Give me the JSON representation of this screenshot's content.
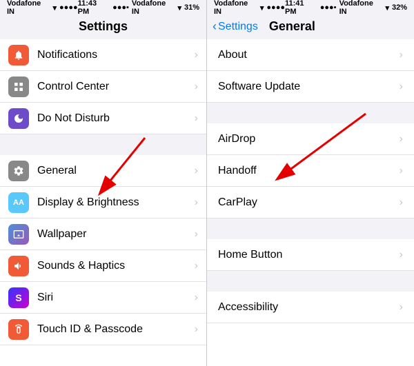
{
  "left": {
    "carrier": "Vodafone IN",
    "time": "11:43 PM",
    "signal": "▌▌▌▌",
    "wifi": "WiFi",
    "battery": "31%",
    "title": "Settings",
    "items": [
      {
        "id": "notifications",
        "label": "Notifications",
        "iconClass": "icon-notifications",
        "icon": "🔔"
      },
      {
        "id": "control-center",
        "label": "Control Center",
        "iconClass": "icon-control",
        "icon": "⊞"
      },
      {
        "id": "do-not-disturb",
        "label": "Do Not Disturb",
        "iconClass": "icon-dnd",
        "icon": "🌙"
      },
      {
        "id": "general",
        "label": "General",
        "iconClass": "icon-general",
        "icon": "⚙"
      },
      {
        "id": "display",
        "label": "Display & Brightness",
        "iconClass": "icon-display",
        "icon": "AA"
      },
      {
        "id": "wallpaper",
        "label": "Wallpaper",
        "iconClass": "icon-wallpaper",
        "icon": "❋"
      },
      {
        "id": "sounds",
        "label": "Sounds & Haptics",
        "iconClass": "icon-sounds",
        "icon": "🔔"
      },
      {
        "id": "siri",
        "label": "Siri",
        "iconClass": "icon-siri",
        "icon": "S"
      },
      {
        "id": "touchid",
        "label": "Touch ID & Passcode",
        "iconClass": "icon-touchid",
        "icon": "◎"
      }
    ]
  },
  "right": {
    "carrier": "Vodafone IN",
    "time": "11:41 PM",
    "signal": "▌▌▌▌",
    "wifi": "WiFi",
    "battery": "32%",
    "back_label": "Settings",
    "title": "General",
    "groups": [
      {
        "items": [
          {
            "id": "about",
            "label": "About"
          },
          {
            "id": "software-update",
            "label": "Software Update"
          }
        ]
      },
      {
        "items": [
          {
            "id": "airdrop",
            "label": "AirDrop"
          },
          {
            "id": "handoff",
            "label": "Handoff"
          },
          {
            "id": "carplay",
            "label": "CarPlay"
          }
        ]
      },
      {
        "items": [
          {
            "id": "home-button",
            "label": "Home Button"
          }
        ]
      },
      {
        "items": [
          {
            "id": "accessibility",
            "label": "Accessibility"
          }
        ]
      }
    ]
  },
  "chevron": "›"
}
